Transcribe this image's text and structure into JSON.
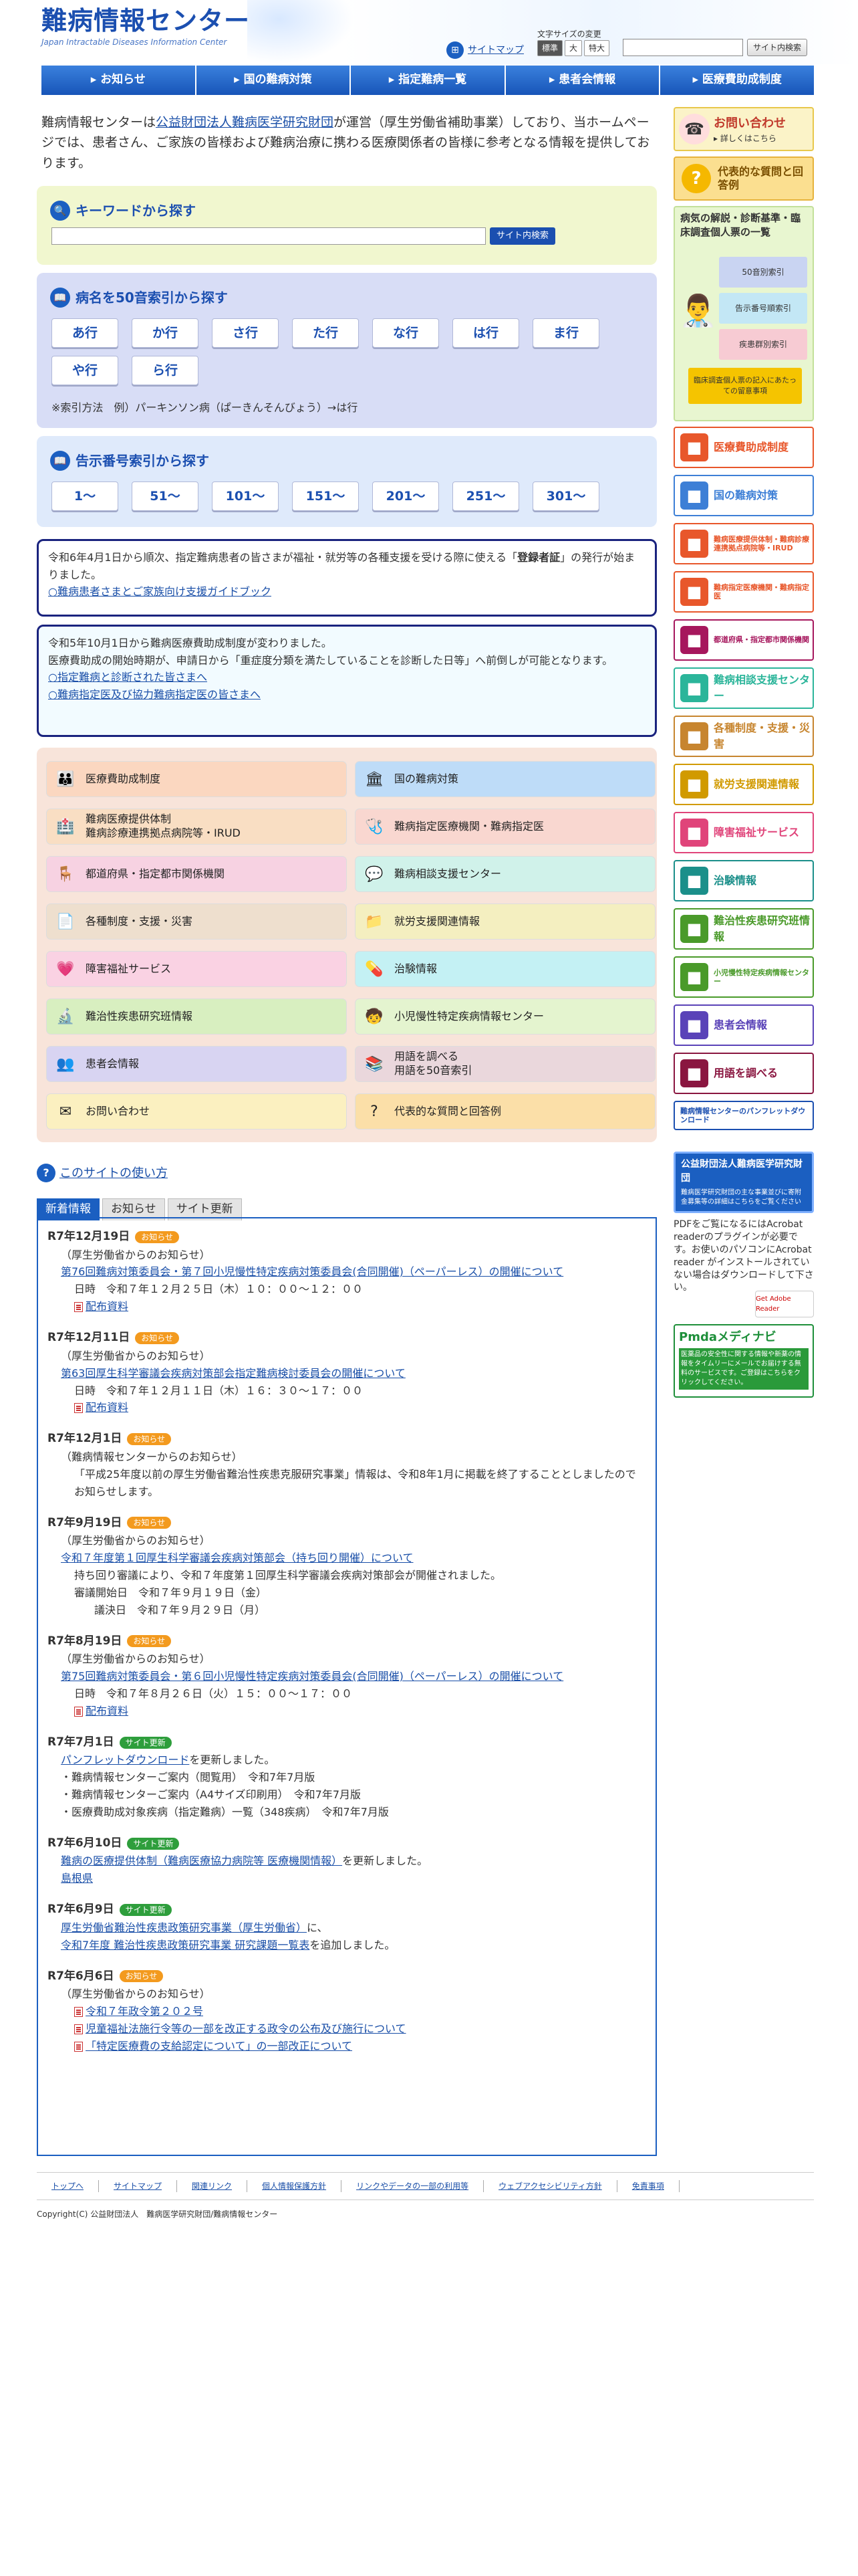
{
  "header": {
    "logo_title": "難病情報センター",
    "logo_sub": "Japan Intractable Diseases Information Center",
    "sitemap": "サイトマップ",
    "font_size_label": "文字サイズの変更",
    "font_sizes": [
      "標準",
      "大",
      "特大"
    ],
    "search_button": "サイト内検索"
  },
  "nav": [
    "お知らせ",
    "国の難病対策",
    "指定難病一覧",
    "患者会情報",
    "医療費助成制度"
  ],
  "intro": {
    "pre": "難病情報センターは",
    "org": "公益財団法人難病医学研究財団",
    "post": "が運営（厚生労働省補助事業）しており、当ホームページでは、患者さん、ご家族の皆様および難病治療に携わる医療関係者の皆様に参考となる情報を提供しております。"
  },
  "keyword": {
    "title": "キーワードから探す",
    "button": "サイト内検索"
  },
  "kana": {
    "title": "病名を50音索引から探す",
    "row1": [
      "あ行",
      "か行",
      "さ行",
      "た行",
      "な行",
      "は行",
      "ま行"
    ],
    "row2": [
      "や行",
      "ら行"
    ],
    "note": "※索引方法　例）パーキンソン病（ぱーきんそんびょう）→は行"
  },
  "number": {
    "title": "告示番号索引から探す",
    "keys": [
      "1～",
      "51～",
      "101～",
      "151～",
      "201～",
      "251～",
      "301～"
    ]
  },
  "notice1": {
    "text_a": "令和6年4月1日から順次、指定難病患者の皆さまが福祉・就労等の各種支援を受ける際に使える「",
    "bold": "登録者証",
    "text_b": "」の発行が始まりました。",
    "link": "○難病患者さまとご家族向け支援ガイドブック"
  },
  "notice2": {
    "line1": "令和5年10月1日から難病医療費助成制度が変わりました。",
    "line2": "医療費助成の開始時期が、申請日から「重症度分類を満たしていることを診断した日等」へ前倒しが可能となります。",
    "link1": "○指定難病と診断された皆さまへ",
    "link2": "○難病指定医及び協力難病指定医の皆さまへ"
  },
  "categories": [
    {
      "label": "医療費助成制度",
      "icon": "family-icon",
      "color": "#fbd7c0"
    },
    {
      "label": "国の難病対策",
      "icon": "capitol-icon",
      "color": "#bedcf8"
    },
    {
      "label": "難病医療提供体制\n難病診療連携拠点病院等・IRUD",
      "icon": "hospital-icon",
      "color": "#f9dec3"
    },
    {
      "label": "難病指定医療機関・難病指定医",
      "icon": "stethoscope-icon",
      "color": "#f9d7d0"
    },
    {
      "label": "都道府県・指定都市関係機関",
      "icon": "chair-icon",
      "color": "#f7d2e2"
    },
    {
      "label": "難病相談支援センター",
      "icon": "consult-icon",
      "color": "#d0f2ea"
    },
    {
      "label": "各種制度・支援・災害",
      "icon": "document-icon",
      "color": "#eedfce"
    },
    {
      "label": "就労支援関連情報",
      "icon": "folder-icon",
      "color": "#f4efc0"
    },
    {
      "label": "障害福祉サービス",
      "icon": "heart-icon",
      "color": "#fad2e3"
    },
    {
      "label": "治験情報",
      "icon": "medicine-icon",
      "color": "#c4f1f4"
    },
    {
      "label": "難治性疾患研究班情報",
      "icon": "microscope-icon",
      "color": "#d8efc0"
    },
    {
      "label": "小児慢性特定疾病情報センター",
      "icon": "child-icon",
      "color": "#e4f4cf"
    },
    {
      "label": "患者会情報",
      "icon": "people-icon",
      "color": "#d8d4f2"
    },
    {
      "label": "用語を調べる\n用語を50音索引",
      "icon": "books-icon",
      "color": "#ead7dc"
    },
    {
      "label": "お問い合わせ",
      "icon": "mail-icon",
      "color": "#fbf0c0"
    },
    {
      "label": "代表的な質問と回答例",
      "icon": "question-icon",
      "color": "#fbdfa8"
    }
  ],
  "help_link": "このサイトの使い方",
  "tabs": [
    "新着情報",
    "お知らせ",
    "サイト更新"
  ],
  "news": [
    {
      "date": "R7年12月19日",
      "badge": "お知らせ",
      "src": "（厚生労働省からのお知らせ）",
      "link": "第76回難病対策委員会・第７回小児慢性特定疾病対策委員会(合同開催)（ペーパーレス）の開催について",
      "info": "日時　令和７年１２月２５日（木）１０：００～１２：００",
      "pdf": "配布資料"
    },
    {
      "date": "R7年12月11日",
      "badge": "お知らせ",
      "src": "（厚生労働省からのお知らせ）",
      "link": "第63回厚生科学審議会疾病対策部会指定難病検討委員会の開催について",
      "info": "日時　令和７年１２月１１日（木）１６：３０～１７：００",
      "pdf": "配布資料"
    },
    {
      "date": "R7年12月1日",
      "badge": "お知らせ",
      "src": "（難病情報センターからのお知らせ）",
      "text": "「平成25年度以前の厚生労働省難治性疾患克服研究事業」情報は、令和8年1月に掲載を終了することとしましたのでお知らせします。"
    },
    {
      "date": "R7年9月19日",
      "badge": "お知らせ",
      "src": "（厚生労働省からのお知らせ）",
      "link": "令和７年度第１回厚生科学審議会疾病対策部会（持ち回り開催）について",
      "text": "持ち回り審議により、令和７年度第１回厚生科学審議会疾病対策部会が開催されました。",
      "info": "審議開始日　令和７年９月１９日（金）",
      "info2": "議決日　令和７年９月２９日（月）"
    },
    {
      "date": "R7年8月19日",
      "badge": "お知らせ",
      "src": "（厚生労働省からのお知らせ）",
      "link": "第75回難病対策委員会・第６回小児慢性特定疾病対策委員会(合同開催)（ペーパーレス）の開催について",
      "info": "日時　令和７年８月２６日（火）１５：００～１７：００",
      "pdf": "配布資料"
    },
    {
      "date": "R7年7月1日",
      "badge": "サイト更新",
      "link": "パンフレットダウンロード",
      "link_after": "を更新しました。",
      "bullets": [
        "・難病情報センターご案内（閲覧用）　令和7年7月版",
        "・難病情報センターご案内（A4サイズ印刷用）　令和7年7月版",
        "・医療費助成対象疾病（指定難病）一覧（348疾病）　令和7年7月版"
      ]
    },
    {
      "date": "R7年6月10日",
      "badge": "サイト更新",
      "link": "難病の医療提供体制（難病医療協力病院等 医療機関情報）",
      "link_after": "を更新しました。",
      "link2": "島根県"
    },
    {
      "date": "R7年6月9日",
      "badge": "サイト更新",
      "link": "厚生労働省難治性疾患政策研究事業（厚生労働省）",
      "link_after": "に、",
      "link2": "令和7年度 難治性疾患政策研究事業 研究課題一覧表",
      "link2_after": "を追加しました。"
    },
    {
      "date": "R7年6月6日",
      "badge": "お知らせ",
      "src": "（厚生労働省からのお知らせ）",
      "pdfs": [
        "令和７年政令第２０２号",
        "児童福祉法施行令等の一部を改正する政令の公布及び施行について",
        "「特定医療費の支給認定について」の一部改正について"
      ]
    }
  ],
  "sidebar": {
    "contact": "お問い合わせ",
    "contact_sub": "詳しくはこちら",
    "faq": "代表的な質問と回答例",
    "disease_title": "病気の解説・診断基準・臨床調査個人票の一覧",
    "disease_items": [
      "50音別索引",
      "告示番号順索引",
      "疾患群別索引"
    ],
    "disease_note": "臨床調査個人票の記入にあたっての留意事項",
    "buttons": [
      "医療費助成制度",
      "国の難病対策",
      "難病医療提供体制・難病診療連携拠点病院等・IRUD",
      "難病指定医療機関・難病指定医",
      "都道府県・指定都市関係機関",
      "難病相談支援センター",
      "各種制度・支援・災害",
      "就労支援関連情報",
      "障害福祉サービス",
      "治験情報",
      "難治性疾患研究班情報",
      "小児慢性特定疾病情報センター",
      "患者会情報",
      "用語を調べる",
      "難病情報センターのパンフレットダウンロード"
    ],
    "yogo_sub": "用語を50音索引",
    "foundation": "公益財団法人難病医学研究財団",
    "foundation_sub": "難病医学研究財団の主な事業並びに寄附金募集等の詳細はこちらをご覧ください",
    "acrobat": "PDFをご覧になるにはAcrobat readerのプラグインが必要です。お使いのパソコンにAcrobat reader がインストールされていない場合はダウンロードして下さい。",
    "acrobat_btn": "Get Adobe Reader",
    "pmda_title": "Pmdaメディナビ",
    "pmda_text": "医薬品の安全性に関する情報や新薬の情報をタイムリーにメールでお届けする無料のサービスです。ご登録はこちらをクリックしてください。"
  },
  "footer": [
    "トップへ",
    "サイトマップ",
    "関連リンク",
    "個人情報保護方針",
    "リンクやデータの一部の利用等",
    "ウェブアクセシビリティ方針",
    "免責事項"
  ],
  "copyright": "Copyright(C) 公益財団法人　難病医学研究財団/難病情報センター"
}
